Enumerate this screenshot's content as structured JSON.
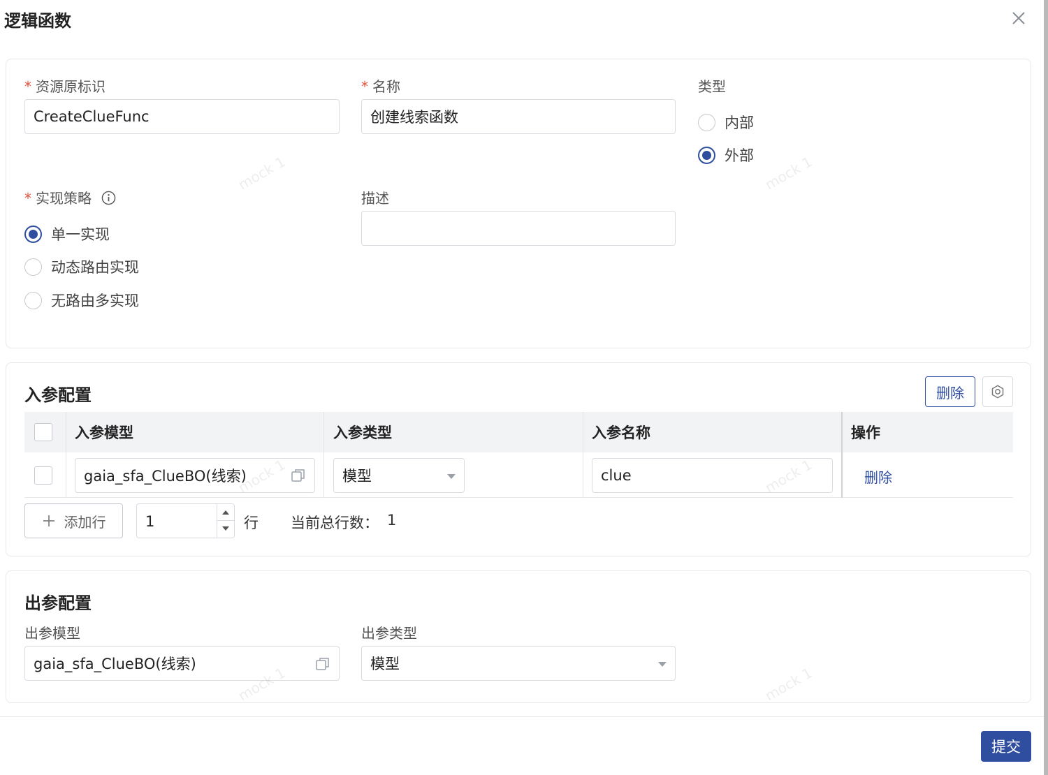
{
  "dialog": {
    "title": "逻辑函数"
  },
  "basic": {
    "resource_id": {
      "label": "资源原标识",
      "value": "CreateClueFunc"
    },
    "name": {
      "label": "名称",
      "value": "创建线索函数"
    },
    "type": {
      "label": "类型",
      "options": [
        "内部",
        "外部"
      ],
      "selected": "外部"
    },
    "strategy": {
      "label": "实现策略",
      "options": [
        "单一实现",
        "动态路由实现",
        "无路由多实现"
      ],
      "selected": "单一实现"
    },
    "description": {
      "label": "描述",
      "value": ""
    }
  },
  "input_config": {
    "title": "入参配置",
    "delete_label": "删除",
    "columns": [
      "入参模型",
      "入参类型",
      "入参名称",
      "操作"
    ],
    "rows": [
      {
        "model": "gaia_sfa_ClueBO(线索)",
        "type": "模型",
        "name": "clue",
        "action": "删除"
      }
    ],
    "add_row_label": "添加行",
    "row_count_value": "1",
    "row_unit": "行",
    "total_label": "当前总行数：",
    "total_value": "1"
  },
  "output_config": {
    "title": "出参配置",
    "model": {
      "label": "出参模型",
      "value": "gaia_sfa_ClueBO(线索)"
    },
    "type": {
      "label": "出参类型",
      "value": "模型"
    }
  },
  "footer": {
    "submit_label": "提交"
  },
  "watermark": "mock 1",
  "colors": {
    "primary": "#2f4ea0",
    "required": "#e0533d",
    "border": "#d8dbe0",
    "table_header_bg": "#f2f3f5"
  },
  "icons": [
    "close-icon",
    "info-icon",
    "gear-icon",
    "copy-icon",
    "plus-icon",
    "chevron-down-icon",
    "caret-up-icon",
    "caret-down-icon"
  ]
}
